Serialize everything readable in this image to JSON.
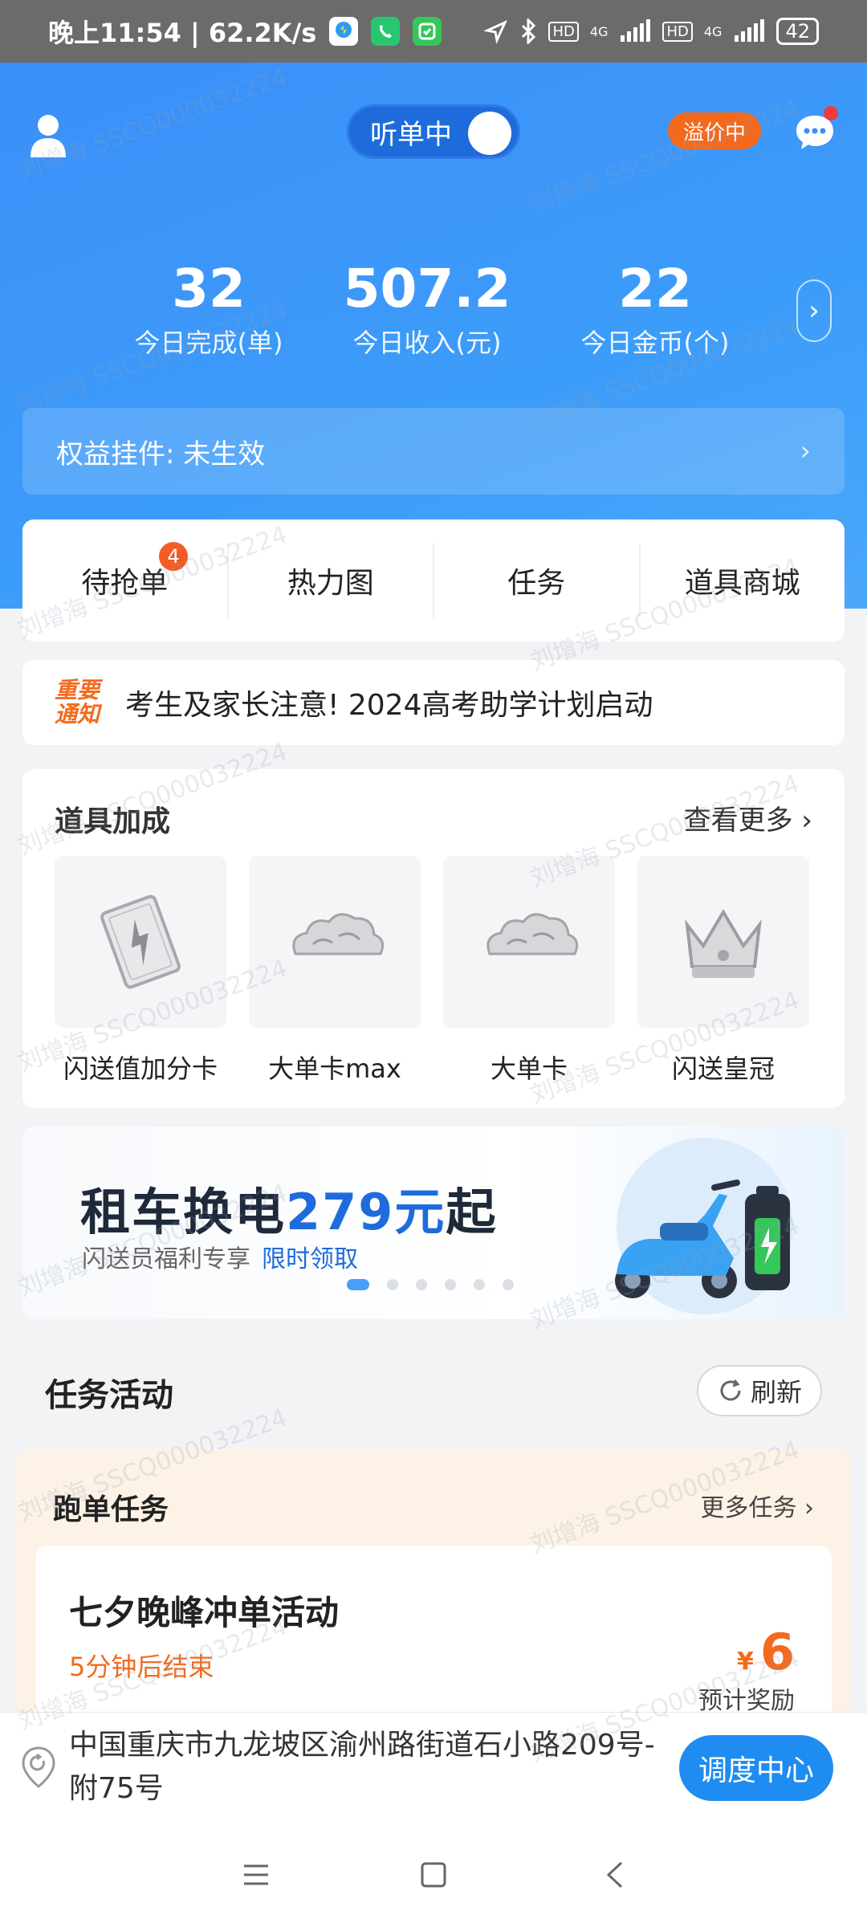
{
  "status_bar": {
    "time_speed": "晚上11:54 | 62.2K/s",
    "network_1": "4G",
    "network_2": "4G",
    "hd_1": "HD",
    "hd_2": "HD",
    "battery": "42"
  },
  "header": {
    "listen_toggle_label": "听单中",
    "premium_badge": "溢价中",
    "stats": [
      {
        "value": "32",
        "label": "今日完成(单)"
      },
      {
        "value": "507.2",
        "label": "今日收入(元)"
      },
      {
        "value": "22",
        "label": "今日金币(个)"
      }
    ],
    "benefit_label": "权益挂件: 未生效"
  },
  "tabs": [
    {
      "label": "待抢单",
      "badge": "4"
    },
    {
      "label": "热力图"
    },
    {
      "label": "任务"
    },
    {
      "label": "道具商城"
    }
  ],
  "notice": {
    "tag_line1": "重要",
    "tag_line2": "通知",
    "text": "考生及家长注意! 2024高考助学计划启动"
  },
  "props": {
    "title": "道具加成",
    "more_label": "查看更多",
    "items": [
      {
        "name": "闪送值加分卡",
        "icon": "lightning-card-icon"
      },
      {
        "name": "大单卡max",
        "icon": "cloud-icon"
      },
      {
        "name": "大单卡",
        "icon": "cloud-icon"
      },
      {
        "name": "闪送皇冠",
        "icon": "crown-icon"
      }
    ]
  },
  "banner": {
    "title_prefix": "租车换电",
    "title_highlight": "279元",
    "title_suffix": "起",
    "subtitle": "闪送员福利专享",
    "subtitle_link": "限时领取",
    "dots_total": 6,
    "active_dot": 1
  },
  "tasks": {
    "section_title": "任务活动",
    "refresh_label": "刷新",
    "card_title": "跑单任务",
    "more_label": "更多任务",
    "task_name": "七夕晚峰冲单活动",
    "task_deadline": "5分钟后结束",
    "reward_currency": "¥",
    "reward_value": "6",
    "reward_label": "预计奖励"
  },
  "location": {
    "address": "中国重庆市九龙坡区渝州路街道石小路209号-附75号",
    "dispatch_label": "调度中心"
  },
  "watermark": "刘增海 SSCQ000032224",
  "colors": {
    "primary_blue": "#3b8ff8",
    "accent_orange": "#f36a1d",
    "dispatch_blue": "#1e8cf0"
  }
}
